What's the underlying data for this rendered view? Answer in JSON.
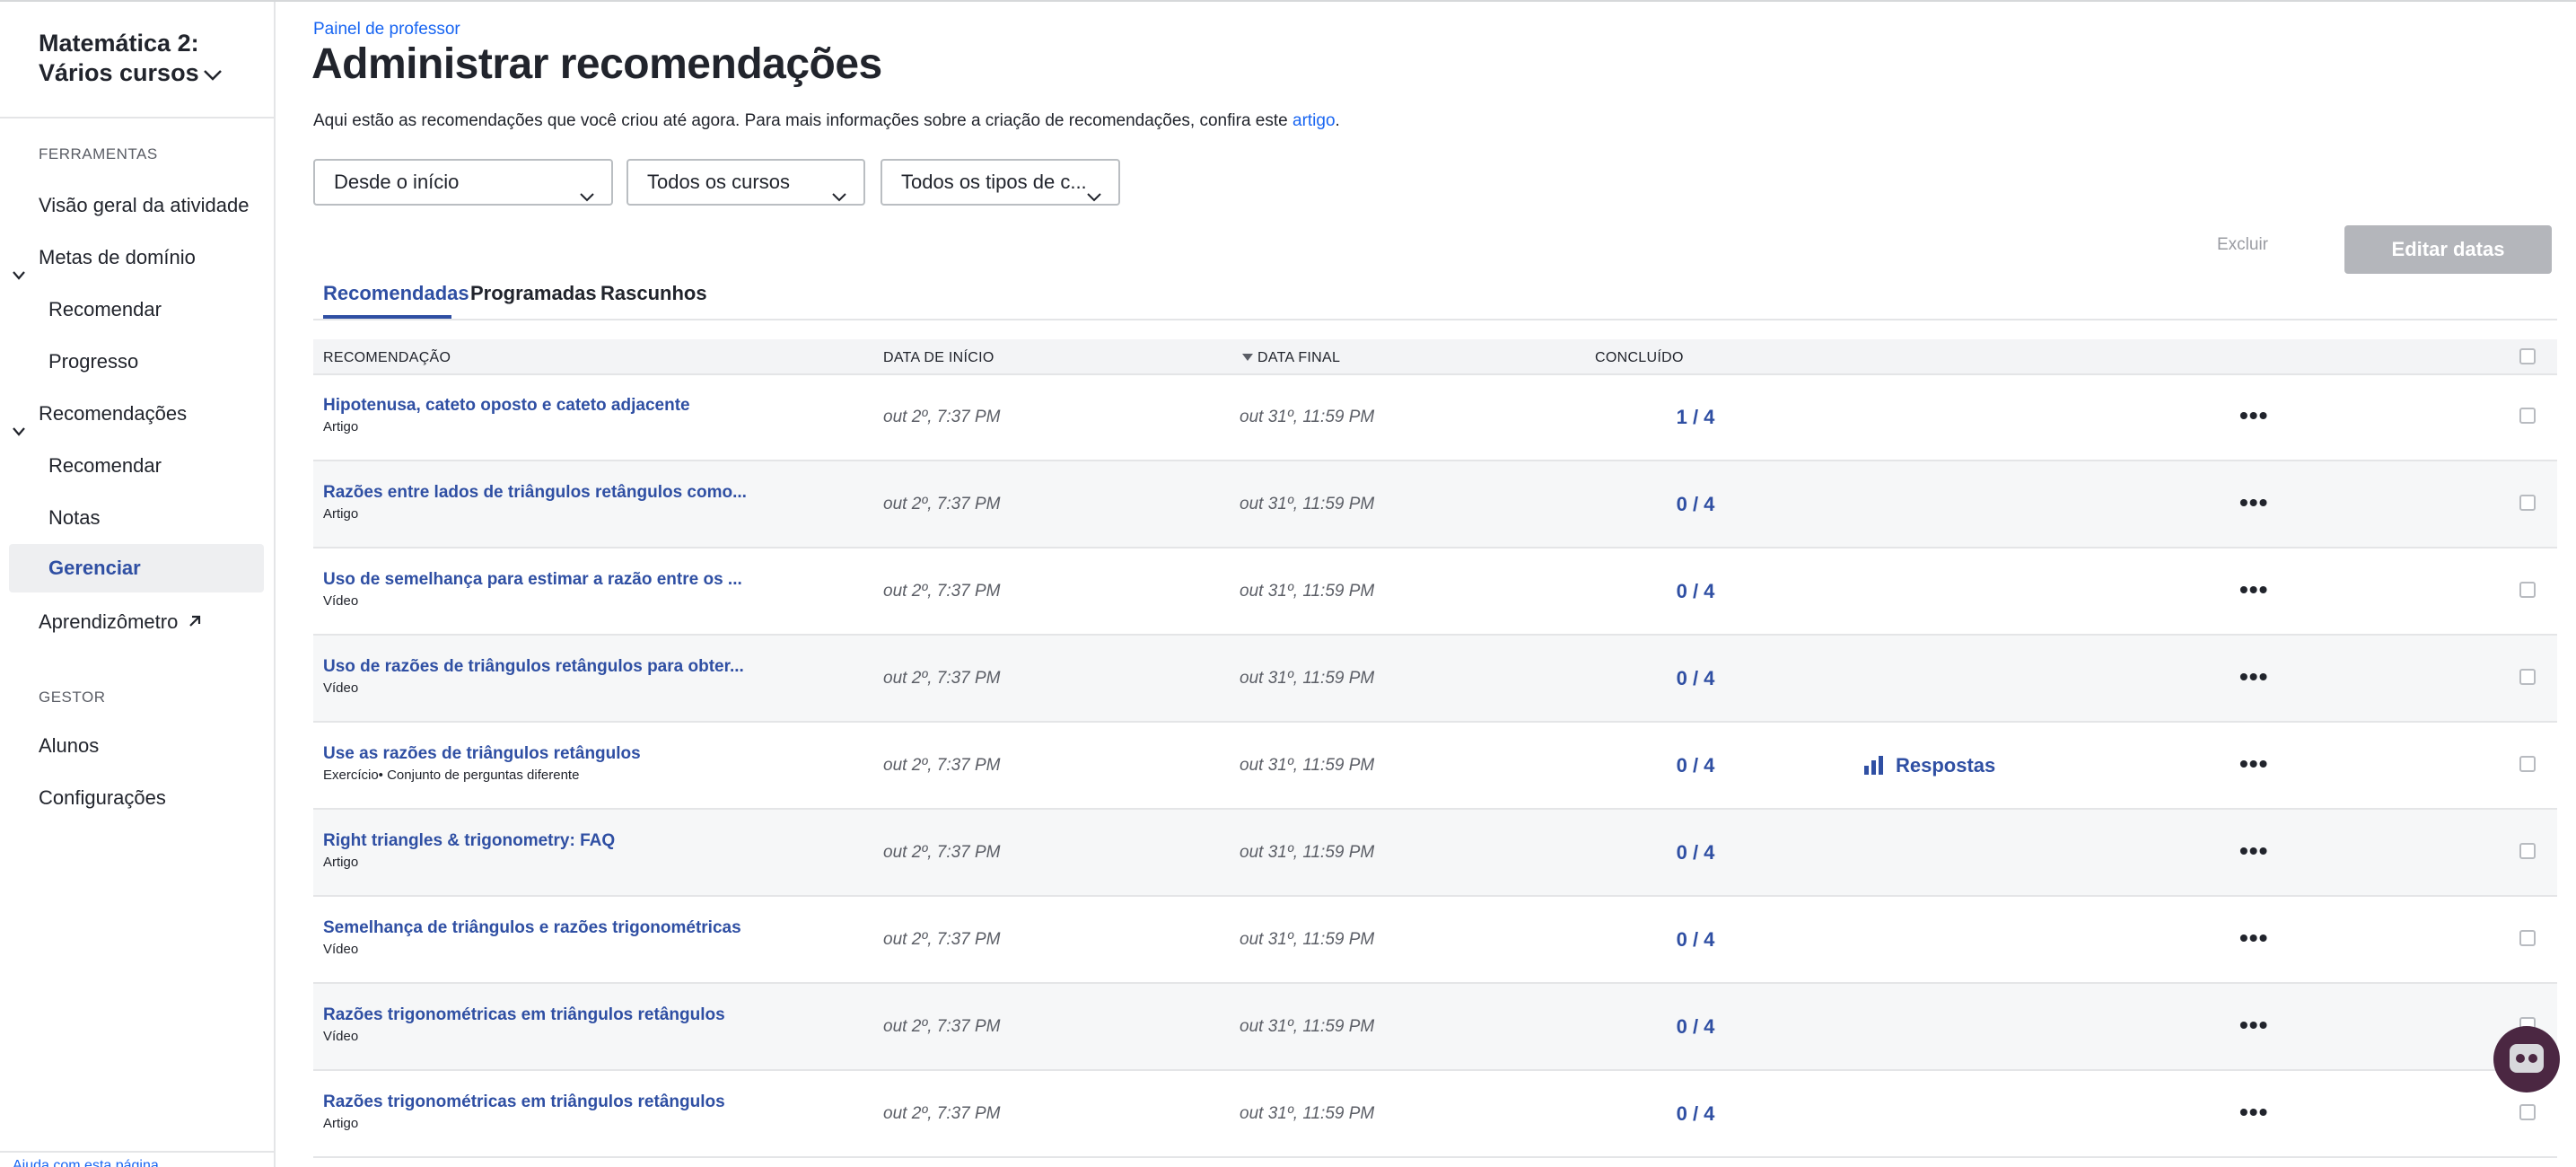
{
  "sidebar": {
    "course_title_line1": "Matemática 2:",
    "course_title_line2": "Vários cursos",
    "section_tools": "FERRAMENTAS",
    "activity_overview": "Visão geral da atividade",
    "mastery_goals": "Metas de domínio",
    "mastery_recommend": "Recomendar",
    "mastery_progress": "Progresso",
    "recommendations": "Recomendações",
    "rec_recommend": "Recomendar",
    "rec_grades": "Notas",
    "rec_manage": "Gerenciar",
    "learnometer": "Aprendizômetro",
    "section_manager": "GESTOR",
    "students": "Alunos",
    "settings": "Configurações",
    "footer_help": "Ajuda com esta página"
  },
  "header": {
    "breadcrumb": "Painel de professor",
    "title": "Administrar recomendações",
    "intro_text": "Aqui estão as recomendações que você criou até agora. Para mais informações sobre a criação de recomendações, confira este ",
    "intro_link": "artigo",
    "intro_end": "."
  },
  "filters": {
    "date": "Desde o início",
    "courses": "Todos os cursos",
    "types": "Todos os tipos de c..."
  },
  "actions": {
    "delete": "Excluir",
    "edit_dates": "Editar datas"
  },
  "tabs": [
    {
      "label": "Recomendadas",
      "active": true
    },
    {
      "label": "Programadas",
      "active": false
    },
    {
      "label": "Rascunhos",
      "active": false
    }
  ],
  "table": {
    "headers": {
      "recommendation": "RECOMENDAÇÃO",
      "start_date": "DATA DE INÍCIO",
      "end_date": "DATA FINAL",
      "completed": "CONCLUÍDO"
    },
    "rows": [
      {
        "title": "Hipotenusa, cateto oposto e cateto adjacente",
        "type": "Artigo",
        "start": "out 2º, 7:37 PM",
        "end": "out 31º, 11:59 PM",
        "done": "1 / 4",
        "responses": ""
      },
      {
        "title": "Razões entre lados de triângulos retângulos como...",
        "type": "Artigo",
        "start": "out 2º, 7:37 PM",
        "end": "out 31º, 11:59 PM",
        "done": "0 / 4",
        "responses": ""
      },
      {
        "title": "Uso de semelhança para estimar a razão entre os ...",
        "type": "Vídeo",
        "start": "out 2º, 7:37 PM",
        "end": "out 31º, 11:59 PM",
        "done": "0 / 4",
        "responses": ""
      },
      {
        "title": "Uso de razões de triângulos retângulos para obter...",
        "type": "Vídeo",
        "start": "out 2º, 7:37 PM",
        "end": "out 31º, 11:59 PM",
        "done": "0 / 4",
        "responses": ""
      },
      {
        "title": "Use as razões de triângulos retângulos",
        "type": "Exercício• Conjunto de perguntas diferente",
        "start": "out 2º, 7:37 PM",
        "end": "out 31º, 11:59 PM",
        "done": "0 / 4",
        "responses": "Respostas"
      },
      {
        "title": "Right triangles & trigonometry: FAQ",
        "type": "Artigo",
        "start": "out 2º, 7:37 PM",
        "end": "out 31º, 11:59 PM",
        "done": "0 / 4",
        "responses": ""
      },
      {
        "title": "Semelhança de triângulos e razões trigonométricas",
        "type": "Vídeo",
        "start": "out 2º, 7:37 PM",
        "end": "out 31º, 11:59 PM",
        "done": "0 / 4",
        "responses": ""
      },
      {
        "title": "Razões trigonométricas em triângulos retângulos",
        "type": "Vídeo",
        "start": "out 2º, 7:37 PM",
        "end": "out 31º, 11:59 PM",
        "done": "0 / 4",
        "responses": ""
      },
      {
        "title": "Razões trigonométricas em triângulos retângulos",
        "type": "Artigo",
        "start": "out 2º, 7:37 PM",
        "end": "out 31º, 11:59 PM",
        "done": "0 / 4",
        "responses": ""
      }
    ],
    "more_label": "•••"
  },
  "icons": {
    "course_dropdown": "chevron-down-icon",
    "external_link": "arrow-up-right-icon",
    "responses": "bar-chart-icon",
    "more": "ellipsis-icon",
    "help": "robot-help-icon"
  },
  "colors": {
    "accent": "#2f4fa3",
    "link": "#1865f2",
    "disabled_button": "#b4b6bb"
  }
}
